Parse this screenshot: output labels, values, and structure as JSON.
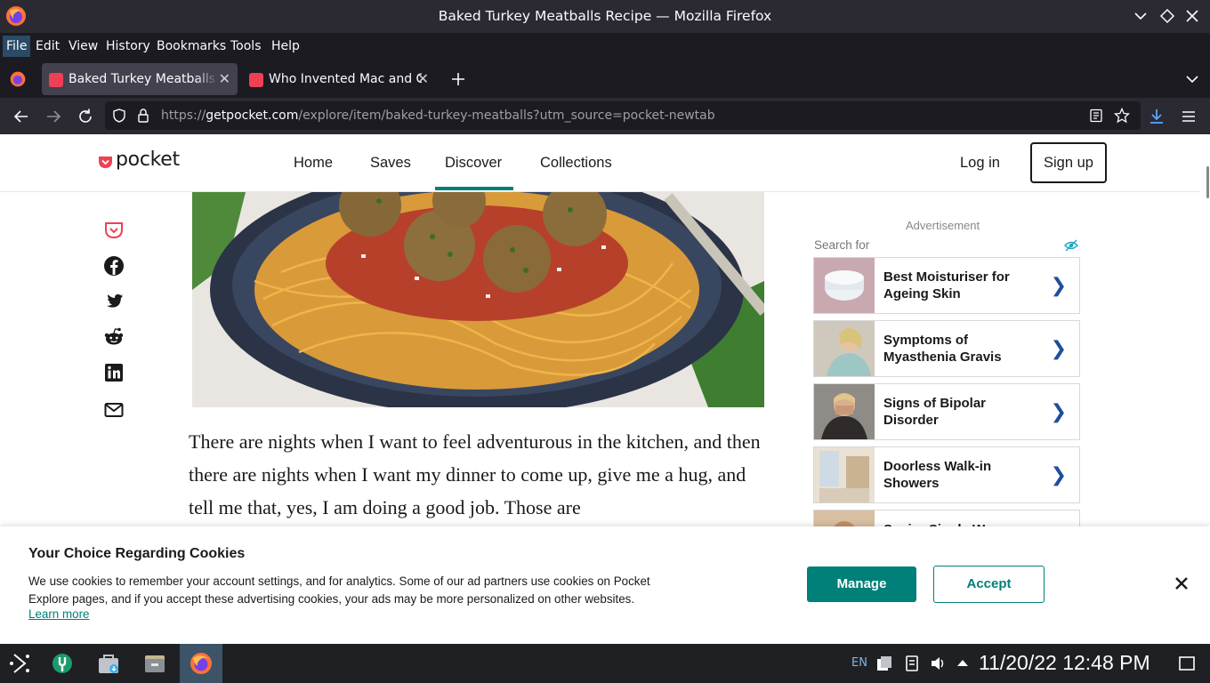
{
  "window": {
    "title": "Baked Turkey Meatballs Recipe — Mozilla Firefox"
  },
  "menu": [
    "File",
    "Edit",
    "View",
    "History",
    "Bookmarks",
    "Tools",
    "Help"
  ],
  "tabs": [
    {
      "label": "Baked Turkey Meatballs Re",
      "active": true,
      "favicon": "pocket-icon"
    },
    {
      "label": "Who Invented Mac and Che",
      "active": false,
      "favicon": "pocket-icon"
    }
  ],
  "urlbar": {
    "prefix": "https://",
    "domain": "getpocket.com",
    "path": "/explore/item/baked-turkey-meatballs?utm_source=pocket-newtab"
  },
  "site": {
    "logo_text": "pocket",
    "nav": [
      "Home",
      "Saves",
      "Discover",
      "Collections"
    ],
    "active_nav": "Discover",
    "login": "Log in",
    "signup": "Sign up"
  },
  "article": {
    "text": "There are nights when I want to feel adventurous in the kitchen, and then there are nights when I want my dinner to come up, give me a hug, and tell me that, yes, I am doing a good job. Those are"
  },
  "ads": {
    "label": "Advertisement",
    "search_for": "Search for",
    "items": [
      {
        "title": "Best Moisturiser for Ageing Skin"
      },
      {
        "title": "Symptoms of Myasthenia Gravis"
      },
      {
        "title": "Signs of Bipolar Disorder"
      },
      {
        "title": "Doorless Walk-in Showers"
      },
      {
        "title": "Senior Single W..."
      }
    ]
  },
  "cookie": {
    "title": "Your Choice Regarding Cookies",
    "text": "We use cookies to remember your account settings, and for analytics. Some of our ad partners use cookies on Pocket Explore pages, and if you accept these advertising cookies, your ads may be more personalized on other websites.",
    "learn_more": "Learn more",
    "manage": "Manage",
    "accept": "Accept"
  },
  "taskbar": {
    "lang": "EN",
    "clock": "11/20/22 12:48 PM"
  },
  "colors": {
    "pocket_red": "#ef4056",
    "teal": "#008078",
    "firefox_dark": "#2b2a33"
  }
}
